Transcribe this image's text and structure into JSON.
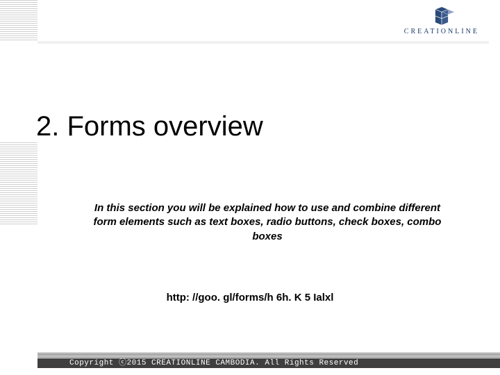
{
  "brand": {
    "name": "CREATIONLINE",
    "logo_icon": "cube-grid-icon",
    "accent_color": "#1a3a6a"
  },
  "slide": {
    "title": "2. Forms overview",
    "description": "In this section you will be explained how to use and combine different form elements such as text boxes, radio buttons, check boxes, combo boxes",
    "url": "http: //goo. gl/forms/h 6h. K 5 Ialxl"
  },
  "footer": {
    "copyright": "Copyright ⓒ2015 CREATIONLINE CAMBODIA. All Rights Reserved"
  }
}
